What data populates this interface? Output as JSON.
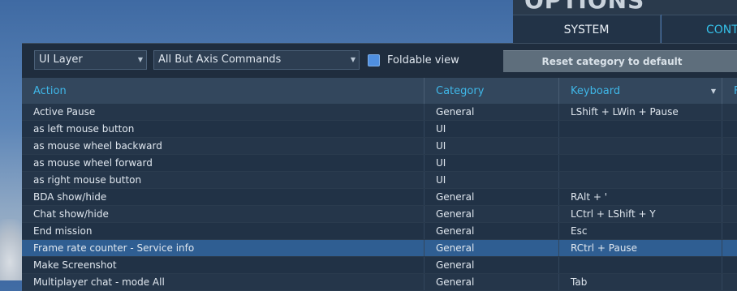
{
  "window": {
    "title": "OPTIONS"
  },
  "tabs": [
    {
      "label": "SYSTEM"
    },
    {
      "label": "CONT"
    }
  ],
  "toolbar": {
    "layer_select": "UI Layer",
    "commands_select": "All But Axis Commands",
    "foldable_label": "Foldable view",
    "foldable_checked": true,
    "reset_label": "Reset category to default"
  },
  "table": {
    "headers": {
      "action": "Action",
      "category": "Category",
      "keyboard": "Keyboard",
      "extra": "F"
    },
    "rows": [
      {
        "action": "Active Pause",
        "category": "General",
        "keyboard": "LShift + LWin + Pause"
      },
      {
        "action": "as left mouse button",
        "category": "UI",
        "keyboard": ""
      },
      {
        "action": "as mouse wheel backward",
        "category": "UI",
        "keyboard": ""
      },
      {
        "action": "as mouse wheel forward",
        "category": "UI",
        "keyboard": ""
      },
      {
        "action": "as right mouse button",
        "category": "UI",
        "keyboard": ""
      },
      {
        "action": "BDA show/hide",
        "category": "General",
        "keyboard": "RAlt + '"
      },
      {
        "action": "Chat show/hide",
        "category": "General",
        "keyboard": "LCtrl + LShift + Y"
      },
      {
        "action": "End mission",
        "category": "General",
        "keyboard": "Esc"
      },
      {
        "action": "Frame rate counter - Service info",
        "category": "General",
        "keyboard": "RCtrl + Pause",
        "selected": true
      },
      {
        "action": "Make Screenshot",
        "category": "General",
        "keyboard": ""
      },
      {
        "action": "Multiplayer chat - mode All",
        "category": "General",
        "keyboard": "Tab"
      }
    ]
  },
  "colors": {
    "accent": "#3fb7e8",
    "selected_row": "#2f5e92",
    "panel": "#1f2d3e"
  }
}
